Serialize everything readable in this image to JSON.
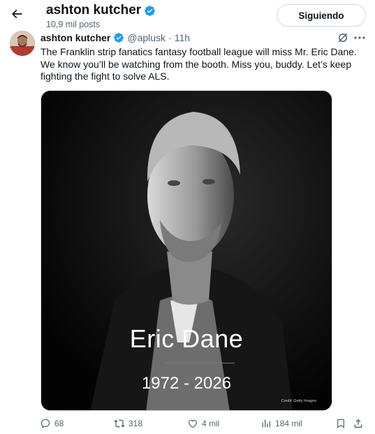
{
  "header": {
    "back_icon": "arrow-left-icon",
    "name": "ashton kutcher",
    "posts": "10,9 mil posts",
    "follow_label": "Siguiendo"
  },
  "tweet": {
    "author_name": "ashton kutcher",
    "handle": "@aplusk",
    "separator": "·",
    "time": "11h",
    "text": "The Franklin strip fanatics fantasy football league will miss Mr. Eric Dane. We know you’ll be watching from the booth.  Miss you, buddy.  Let’s keep fighting the fight to solve ALS.",
    "media": {
      "overlay_name": "Eric Dane",
      "overlay_years": "1972 - 2026",
      "credit": "Credit: Getty Images"
    }
  },
  "actions": {
    "replies": "68",
    "reposts": "318",
    "likes": "4 mil",
    "views": "184 mil"
  },
  "colors": {
    "verified": "#1d9bf0",
    "muted_text": "#536471",
    "primary_text": "#0f1419",
    "border": "#cfd9de"
  }
}
